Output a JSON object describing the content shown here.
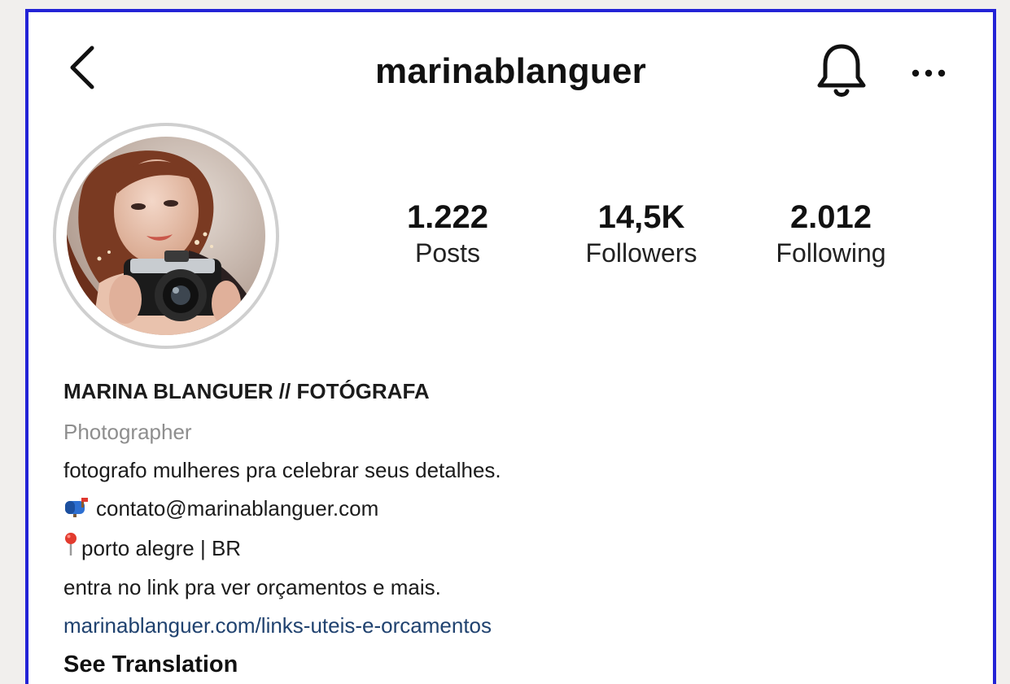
{
  "header": {
    "username": "marinablanguer",
    "icons": {
      "back": "chevron-left-icon",
      "bell": "bell-icon",
      "more": "more-horizontal-icon"
    }
  },
  "stats": [
    {
      "value": "1.222",
      "label": "Posts"
    },
    {
      "value": "14,5K",
      "label": "Followers"
    },
    {
      "value": "2.012",
      "label": "Following"
    }
  ],
  "bio": {
    "name": "MARINA BLANGUER // FOTÓGRAFA",
    "category": "Photographer",
    "line1": "fotografo mulheres pra celebrar seus detalhes.",
    "email_icon": "mailbox-icon",
    "email": "contato@marinablanguer.com",
    "location_icon": "pin-icon",
    "location": "porto alegre | BR",
    "line4": "entra no link pra ver orçamentos e mais.",
    "link": "marinablanguer.com/links-uteis-e-orcamentos",
    "see_translation": "See Translation"
  },
  "colors": {
    "frame_border": "#2323d6",
    "link": "#20426f",
    "category": "#8e8e8e",
    "avatar_ring": "#cfcfcf"
  }
}
